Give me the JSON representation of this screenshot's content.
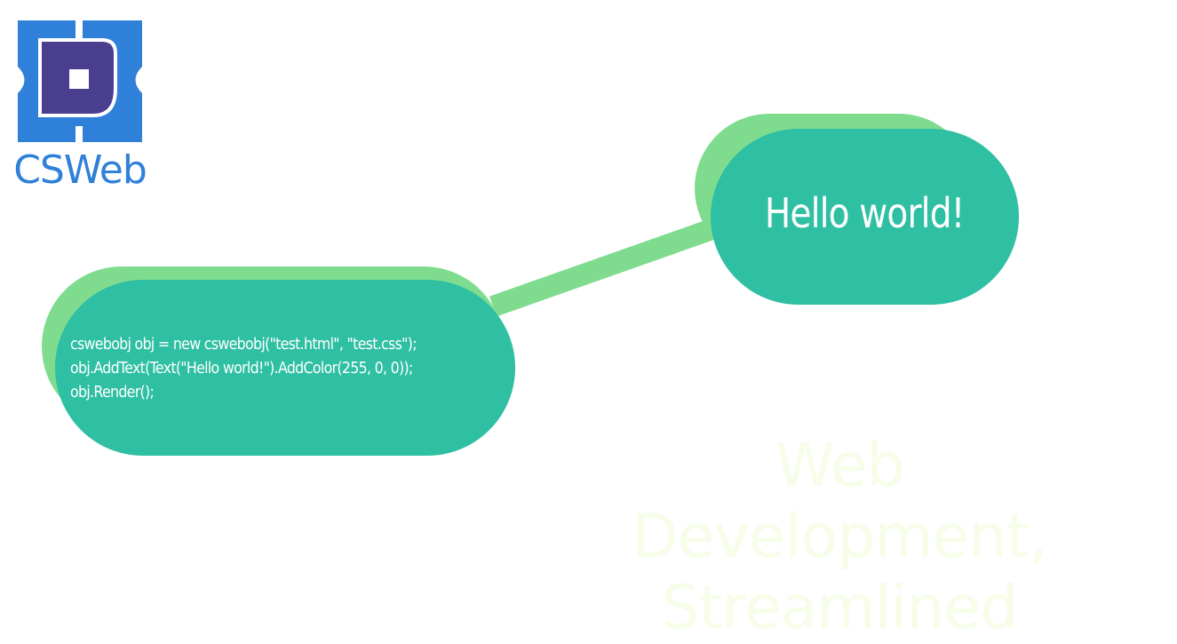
{
  "logo": {
    "text": "CSWeb",
    "colors": {
      "outer": "#2f80d9",
      "inner": "#4a3f8f",
      "center": "#ffffff"
    }
  },
  "code_bubble": {
    "lines": [
      "cswebobj obj = new cswebobj(\"test.html\", \"test.css\");",
      "obj.AddText(Text(\"Hello world!\").AddColor(255, 0, 0));",
      "obj.Render();"
    ]
  },
  "hello_bubble": {
    "text": "Hello world!"
  },
  "tagline": {
    "line1": "Web Development,",
    "line2": "Streamlined"
  },
  "colors": {
    "bubble": "#2fbfa3",
    "bubble_shadow": "#7fdc8f",
    "connector": "#7fdc8f",
    "tagline": "#f6fde8"
  }
}
